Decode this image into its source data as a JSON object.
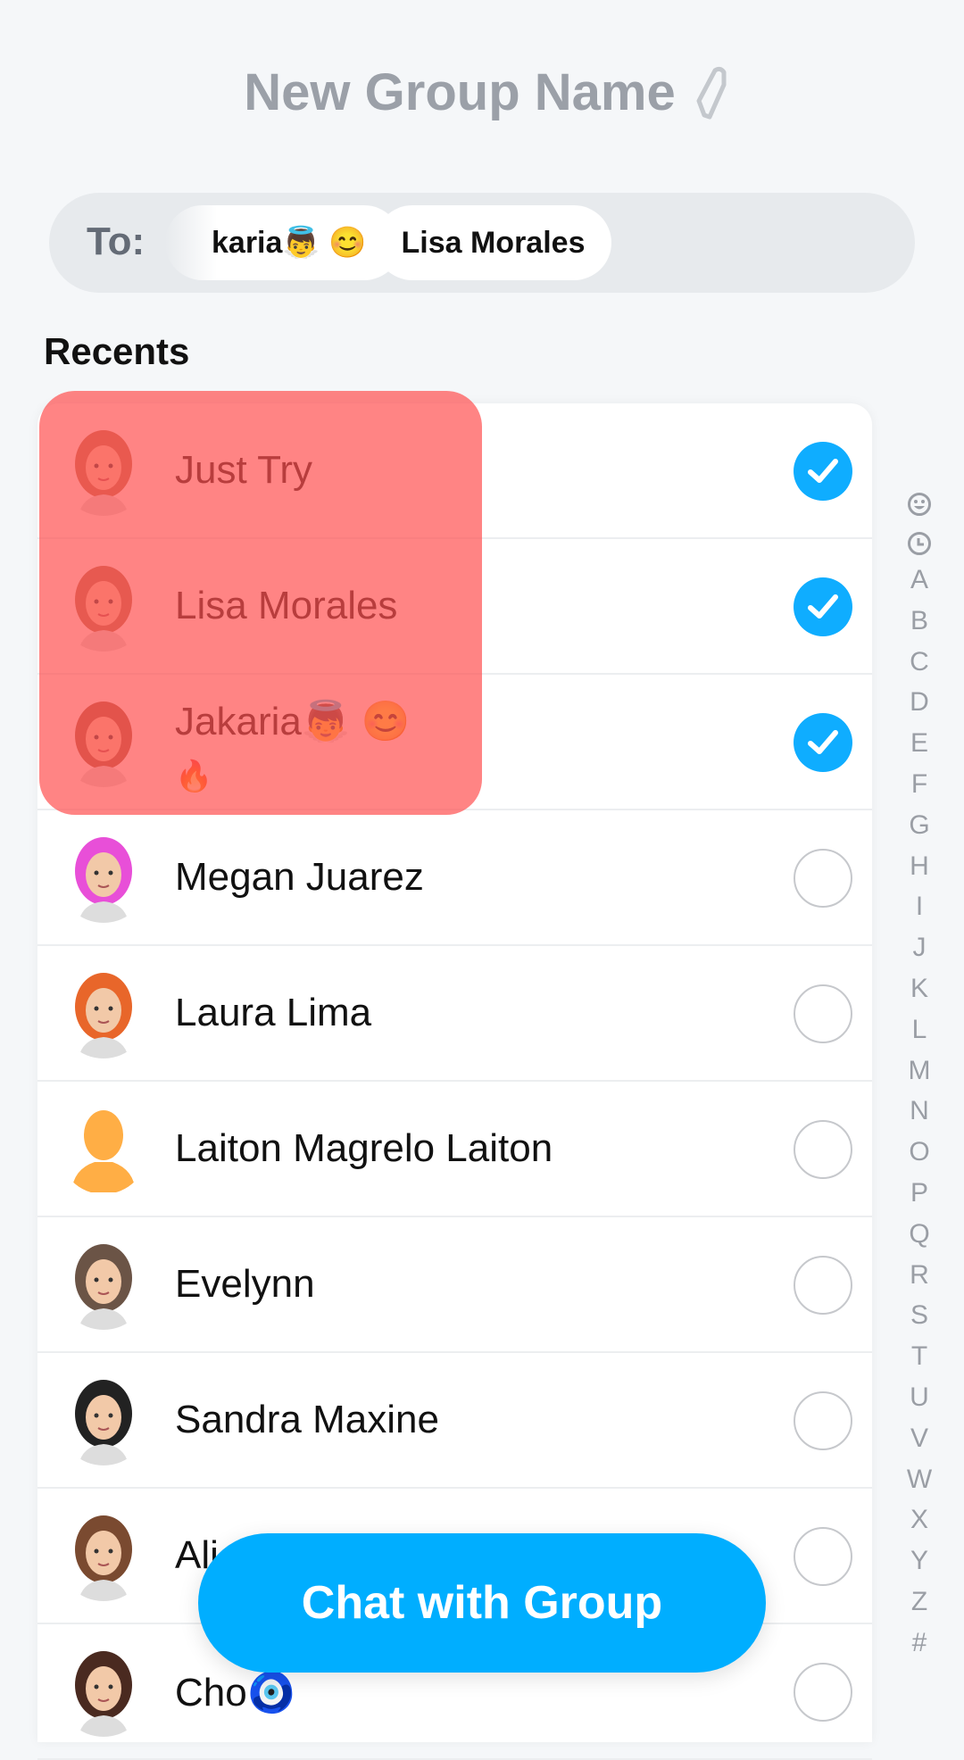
{
  "header": {
    "title": "New Group Name",
    "edit_icon": "pencil-icon"
  },
  "to_bar": {
    "label": "To:",
    "chips": [
      {
        "text": "karia👼 😊"
      },
      {
        "text": "Lisa Morales"
      }
    ]
  },
  "section": {
    "title": "Recents"
  },
  "contacts": [
    {
      "name": "Just Try",
      "selected": true,
      "avatar": "bitmoji-avatar",
      "avatar_color": "#b5714d"
    },
    {
      "name": "Lisa Morales",
      "selected": true,
      "avatar": "bitmoji-avatar",
      "avatar_color": "#b07050"
    },
    {
      "name": "Jakaria👼 😊",
      "name_line2": "🔥",
      "selected": true,
      "avatar": "bitmoji-avatar",
      "avatar_color": "#a05a40"
    },
    {
      "name": "Megan Juarez",
      "selected": false,
      "avatar": "bitmoji-avatar",
      "avatar_color": "#e84fd8"
    },
    {
      "name": "Laura Lima",
      "selected": false,
      "avatar": "bitmoji-avatar",
      "avatar_color": "#e8662a"
    },
    {
      "name": "Laiton Magrelo Laiton",
      "selected": false,
      "avatar": "default-silhouette-avatar",
      "avatar_color": "#ffae45"
    },
    {
      "name": "Evelynn",
      "selected": false,
      "avatar": "bitmoji-avatar",
      "avatar_color": "#6b5446"
    },
    {
      "name": "Sandra Maxine",
      "selected": false,
      "avatar": "bitmoji-avatar",
      "avatar_color": "#222222"
    },
    {
      "name": "Ali",
      "selected": false,
      "avatar": "bitmoji-avatar",
      "avatar_color": "#7a4a30"
    },
    {
      "name": "Cho🧿",
      "selected": false,
      "avatar": "bitmoji-avatar",
      "avatar_color": "#4a2a20"
    }
  ],
  "alpha_index": [
    "A",
    "B",
    "C",
    "D",
    "E",
    "F",
    "G",
    "H",
    "I",
    "J",
    "K",
    "L",
    "M",
    "N",
    "O",
    "P",
    "Q",
    "R",
    "S",
    "T",
    "U",
    "V",
    "W",
    "X",
    "Y",
    "Z",
    "#"
  ],
  "cta": {
    "label": "Chat with Group"
  },
  "colors": {
    "accent": "#00aeff",
    "check": "#0fadff",
    "highlight": "#ff5050"
  }
}
